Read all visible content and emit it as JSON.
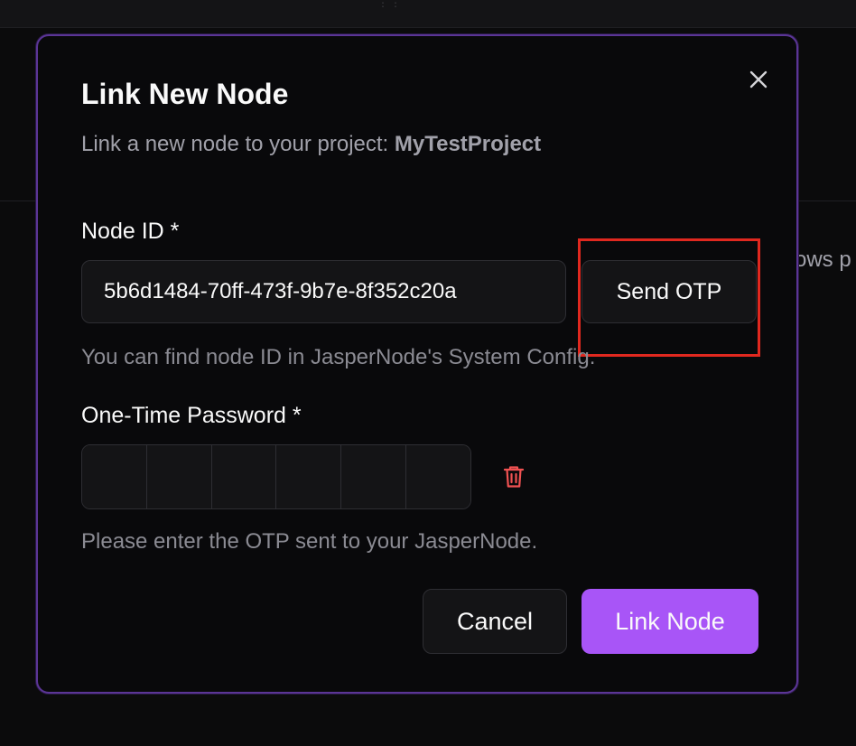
{
  "background": {
    "partial_text": "ows p"
  },
  "modal": {
    "title": "Link New Node",
    "subtitle_prefix": "Link a new node to your project: ",
    "project_name": "MyTestProject",
    "close_icon": "close-icon",
    "accent_color": "#a855f7",
    "border_color": "#5b3596"
  },
  "node_id": {
    "label": "Node ID *",
    "value": "5b6d1484-70ff-473f-9b7e-8f352c20a",
    "send_button_label": "Send OTP",
    "helper": "You can find node ID in JasperNode's System Config."
  },
  "otp": {
    "label": "One-Time Password *",
    "digits": [
      "",
      "",
      "",
      "",
      "",
      ""
    ],
    "clear_icon": "trash-icon",
    "helper": "Please enter the OTP sent to your JasperNode."
  },
  "actions": {
    "cancel_label": "Cancel",
    "submit_label": "Link Node"
  }
}
